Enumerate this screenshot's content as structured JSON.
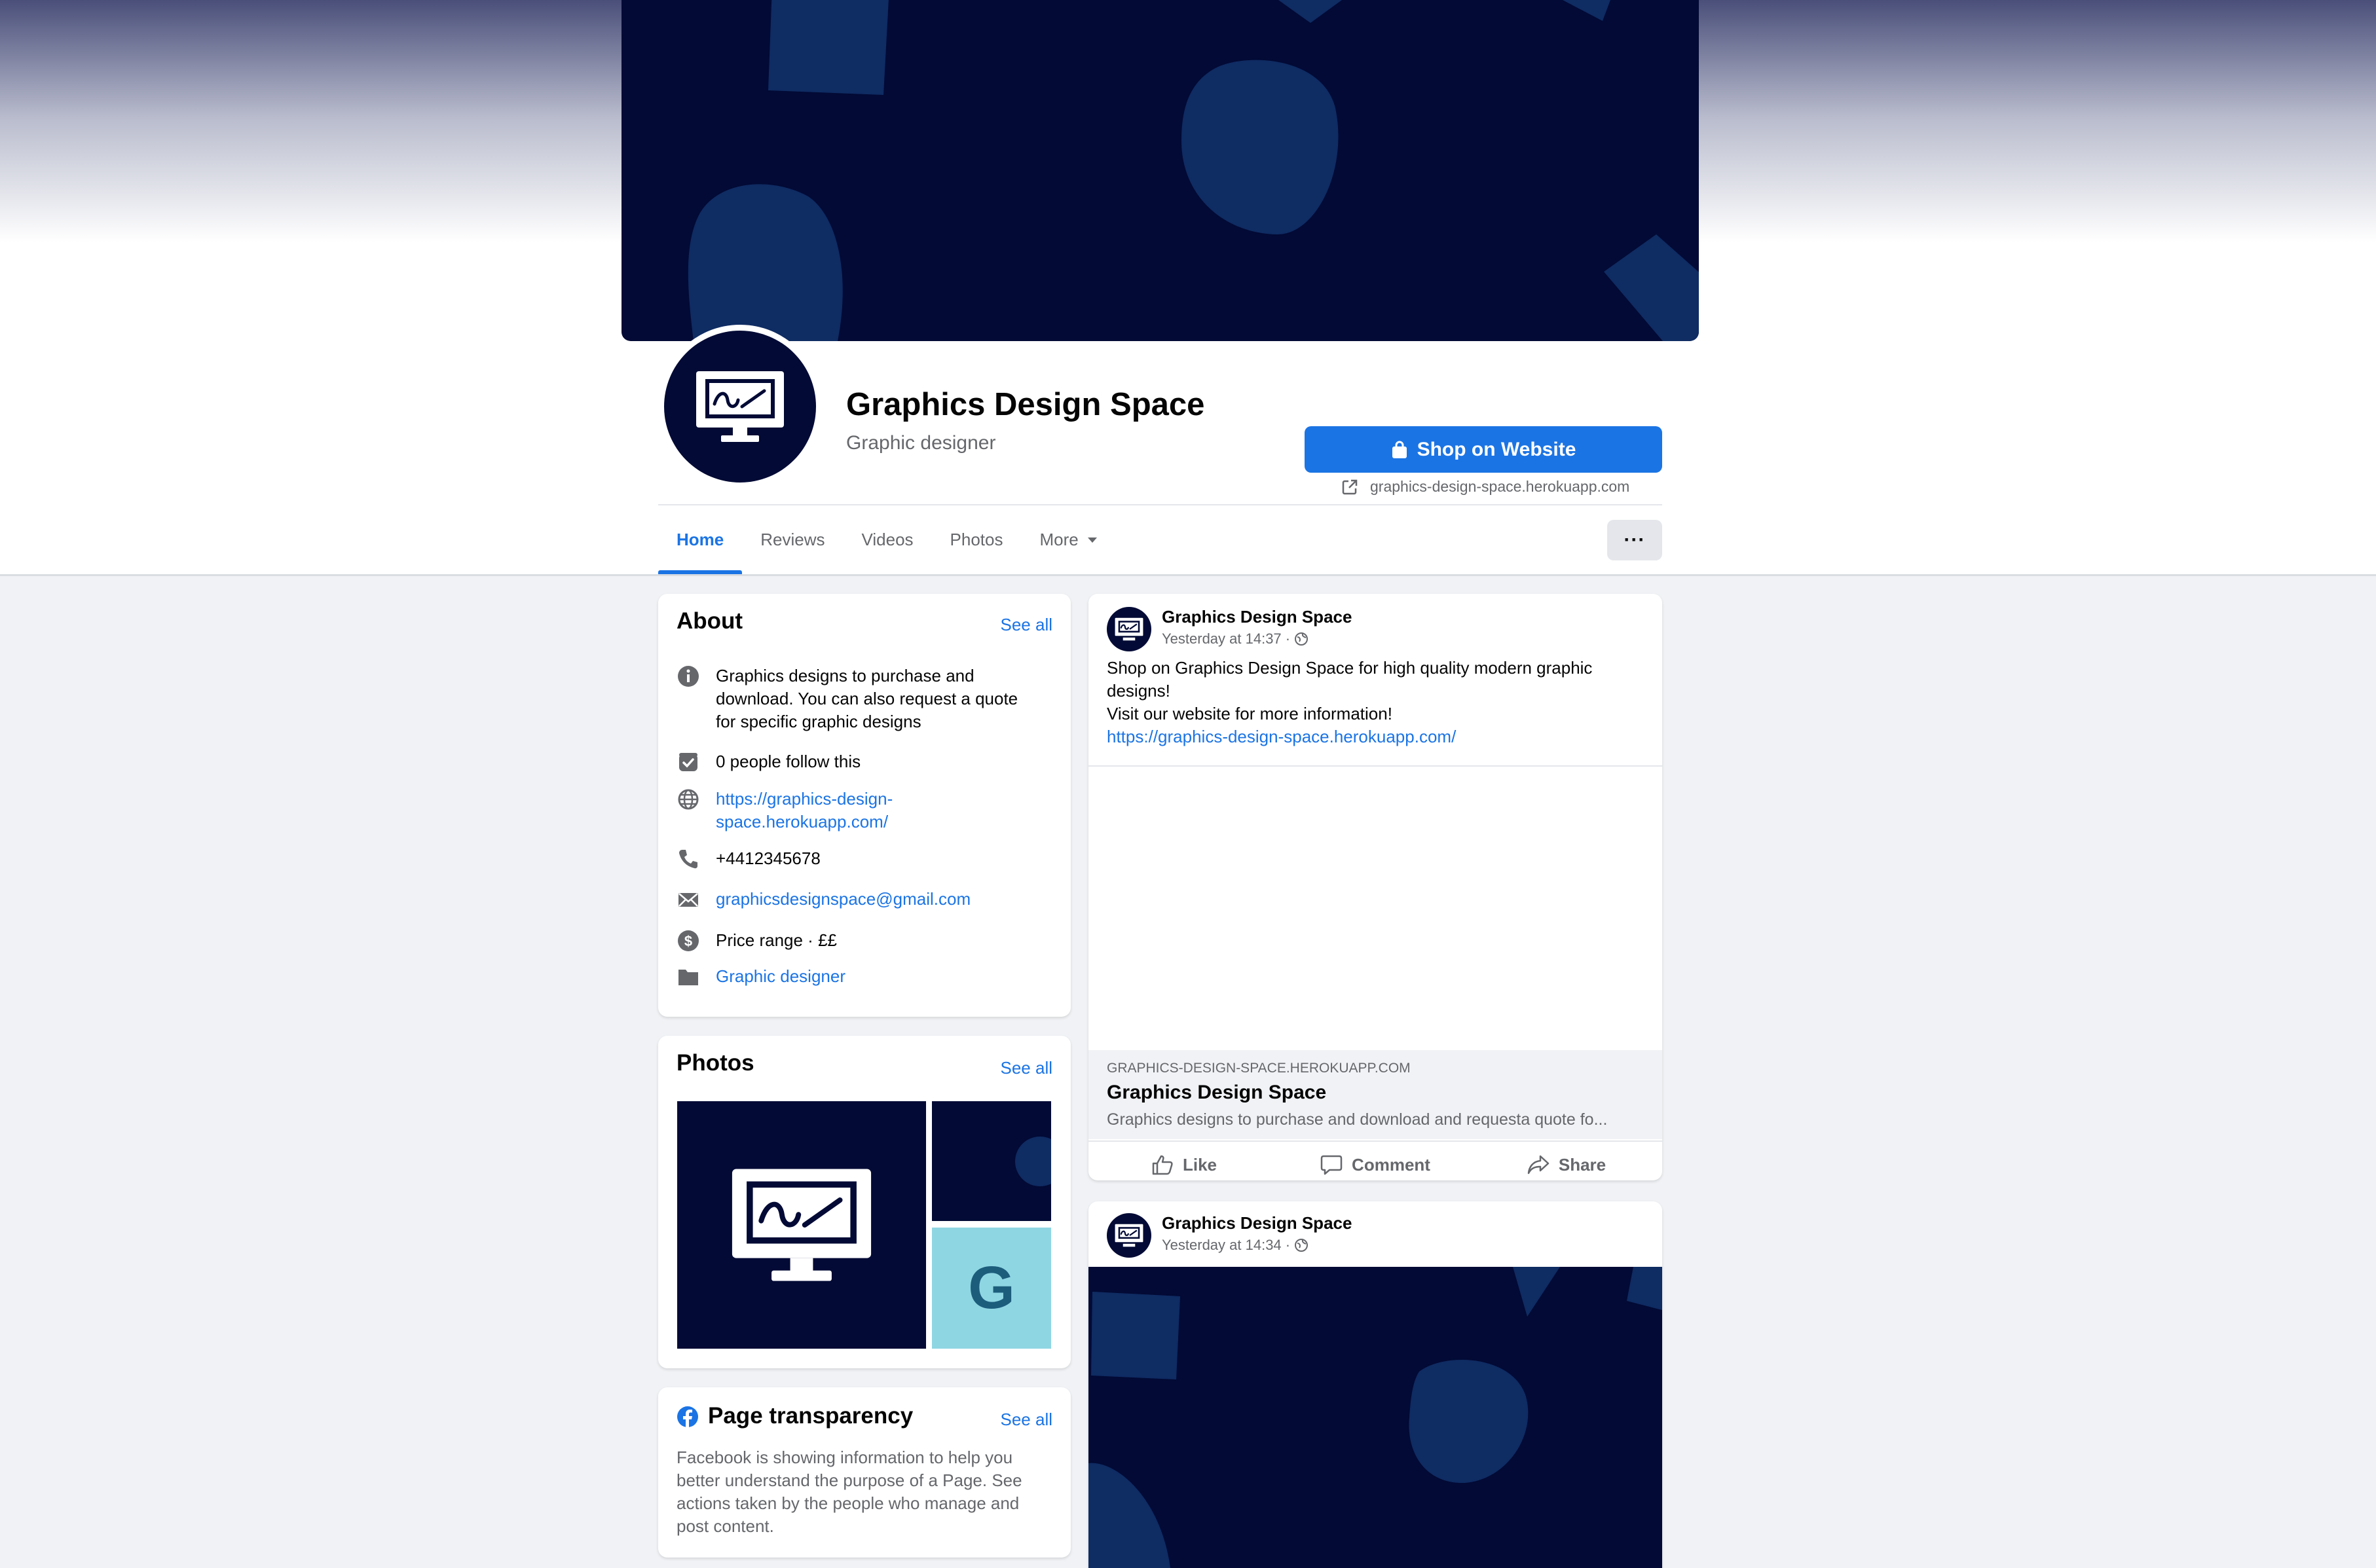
{
  "page": {
    "name": "Graphics Design Space",
    "category": "Graphic designer",
    "shop_button_label": "Shop on Website",
    "website_display": "graphics-design-space.herokuapp.com"
  },
  "tabs": [
    {
      "label": "Home",
      "active": true
    },
    {
      "label": "Reviews"
    },
    {
      "label": "Videos"
    },
    {
      "label": "Photos"
    },
    {
      "label": "More"
    }
  ],
  "more_options_label": "···",
  "about": {
    "title": "About",
    "see_all": "See all",
    "description_lines": [
      "Graphics designs to purchase and",
      "download. You can also request a quote",
      "for specific graphic designs"
    ],
    "followers": "0 people follow this",
    "website_lines": [
      "https://graphics-design-",
      "space.herokuapp.com/"
    ],
    "phone": "+4412345678",
    "email": "graphicsdesignspace@gmail.com",
    "price_range": "Price range · ££",
    "category_link": "Graphic designer"
  },
  "photos": {
    "title": "Photos",
    "see_all": "See all",
    "tile_letter": "G"
  },
  "transparency": {
    "title": "Page transparency",
    "see_all": "See all",
    "text_lines": [
      "Facebook is showing information to help you",
      "better understand the purpose of a Page. See",
      "actions taken by the people who manage and",
      "post content."
    ]
  },
  "posts": [
    {
      "author": "Graphics Design Space",
      "time": "Yesterday at 14:37 ·",
      "text_lines": [
        "Shop on Graphics Design Space for high quality modern graphic",
        "designs!",
        "Visit our website for more information!"
      ],
      "link": "https://graphics-design-space.herokuapp.com/",
      "preview_domain": "GRAPHICS-DESIGN-SPACE.HEROKUAPP.COM",
      "preview_title": "Graphics Design Space",
      "preview_desc": "Graphics designs to purchase and download and requesta quote fo...",
      "actions": [
        "Like",
        "Comment",
        "Share"
      ]
    },
    {
      "author": "Graphics Design Space",
      "time": "Yesterday at 14:34 ·"
    }
  ],
  "colors": {
    "brand_blue": "#1b74e4",
    "cover_navy": "#020a35",
    "shape_blue": "#0f2c63",
    "photo_tile_teal": "#8fd6e3"
  },
  "icons": [
    "shopping-bag-icon",
    "external-link-icon",
    "caret-down-icon",
    "info-icon",
    "follow-check-icon",
    "globe-icon",
    "phone-icon",
    "email-icon",
    "price-icon",
    "category-icon",
    "like-icon",
    "comment-icon",
    "share-icon",
    "facebook-logo-icon"
  ]
}
